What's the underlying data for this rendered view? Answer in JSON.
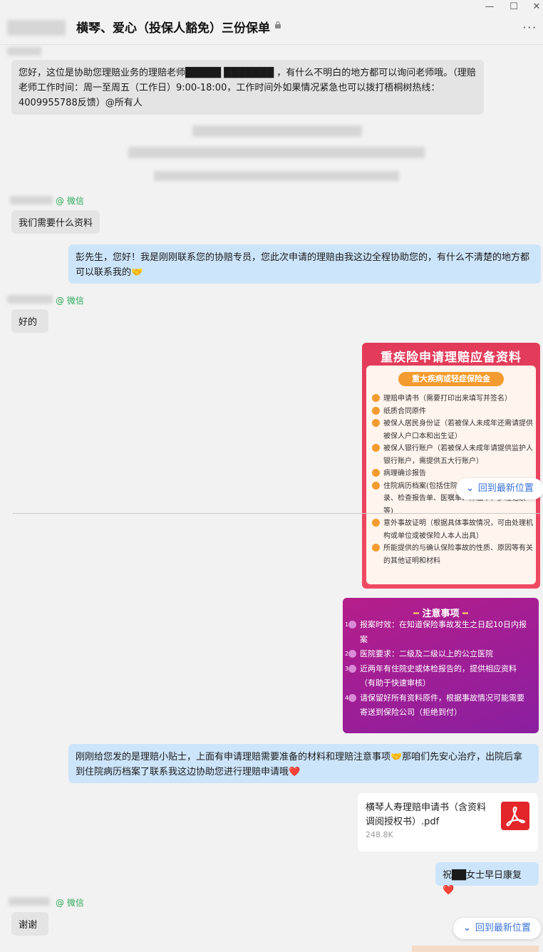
{
  "window": {
    "title": "横琴、爱心（投保人豁免）三份保单",
    "minimize": "—",
    "maximize": "☐",
    "close": "✕",
    "more": "···"
  },
  "messages": {
    "announcement": "您好，这位是协助您理赔业务的理赔老师█████ ███████ ，有什么不明白的地方都可以询问老师哦。（理赔老师工作时间：周一至周五（工作日）9:00-18:00，工作时间外如果情况紧急也可以拨打梧桐树热线：4009955788反馈）@所有人",
    "wechat_tag": "@ 微信",
    "q1": "我们需要什么资料",
    "a1": "彭先生，您好！我是刚刚联系您的协赔专员，您此次申请的理赔由我这边全程协助您的，有什么不清楚的地方都可以联系我的🤝",
    "q2": "好的",
    "tip": "刚刚给您发的是理赔小贴士，上面有申请理赔需要准备的材料和理赔注意事项🤝那咱们先安心治疗，出院后拿到住院病历档案了联系我这边协助您进行理赔申请哦❤️",
    "wish": "祝██女士早日康复❤️",
    "thanks": "谢谢"
  },
  "image1": {
    "banner": "重疾险申请理赔应备资料",
    "subtitle": "重大疾病或轻症保险金",
    "items": [
      "理赔申请书（需要打印出来填写并签名）",
      "纸质合同原件",
      "被保人居民身份证（若被保人未成年还需请提供被保人户口本和出生证）",
      "被保人银行账户（若被保人未成年请提供监护人银行账户，需提供五大行账户）",
      "病理确诊报告",
      "住院病历档案(包括住院…出院记录、手术记录、检查报告单、医嘱单、体温单、护理记录等)",
      "意外事故证明（根据具体事故情况，可由处理机构或单位或被保险人本人出具）",
      "所能提供的与确认保险事故的性质、原因等有关的其他证明和材料"
    ]
  },
  "image2": {
    "heading": "注意事项",
    "items": [
      "报案时效：在知道保险事故发生之日起10日内报案",
      "医院要求：二级及二级以上的公立医院",
      "近两年有住院史或体检报告的，提供相应资料（有助于快速审核）",
      "请保留好所有资料原件，根据事故情况可能需要寄送到保险公司（拒绝到付）"
    ]
  },
  "file": {
    "name": "横琴人寿理赔申请书（含资料调阅授权书）.pdf",
    "size": "248.8K"
  },
  "jump_latest": "回到最新位置",
  "colors": {
    "bubble_blue": "#cde5fb",
    "bubble_gray": "#e4e4e4",
    "wechat_green": "#2faa5b",
    "link_blue": "#3a73d8",
    "pdf_red": "#e2262a"
  }
}
